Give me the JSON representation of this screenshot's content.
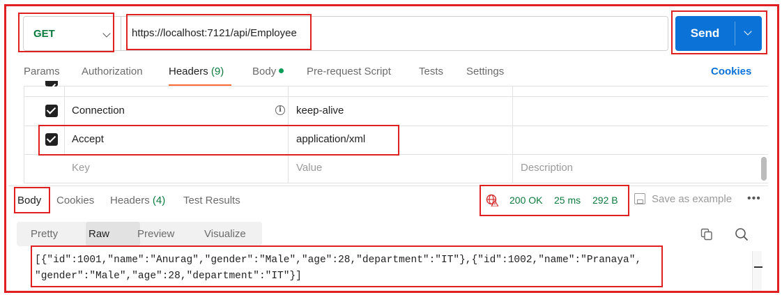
{
  "request": {
    "method": "GET",
    "url": "https://localhost:7121/api/Employee",
    "send_label": "Send"
  },
  "request_tabs": {
    "params": "Params",
    "authorization": "Authorization",
    "headers": "Headers",
    "headers_count": "(9)",
    "body": "Body",
    "pre_request": "Pre-request Script",
    "tests": "Tests",
    "settings": "Settings",
    "cookies": "Cookies"
  },
  "headers_table": {
    "rows": [
      {
        "key": "Connection",
        "value": "keep-alive",
        "checked": true
      },
      {
        "key": "Accept",
        "value": "application/xml",
        "checked": true
      }
    ],
    "placeholder": {
      "key": "Key",
      "value": "Value",
      "description": "Description"
    }
  },
  "response_tabs": {
    "body": "Body",
    "cookies": "Cookies",
    "headers": "Headers",
    "headers_count": "(4)",
    "test_results": "Test Results"
  },
  "response_status": {
    "status": "200 OK",
    "time": "25 ms",
    "size": "292 B",
    "save_example": "Save as example",
    "status_color": "#0c7a3d"
  },
  "format_tabs": {
    "pretty": "Pretty",
    "raw": "Raw",
    "preview": "Preview",
    "visualize": "Visualize",
    "selected": "Raw"
  },
  "response_body": {
    "line1": "[{\"id\":1001,\"name\":\"Anurag\",\"gender\":\"Male\",\"age\":28,\"department\":\"IT\"},{\"id\":1002,\"name\":\"Pranaya\",",
    "line2": "\"gender\":\"Male\",\"age\":28,\"department\":\"IT\"}]"
  },
  "colors": {
    "accent": "#0b72d8",
    "annotation": "#e02020",
    "method": "#0c7a3d",
    "active_tab": "#ff6c37"
  }
}
